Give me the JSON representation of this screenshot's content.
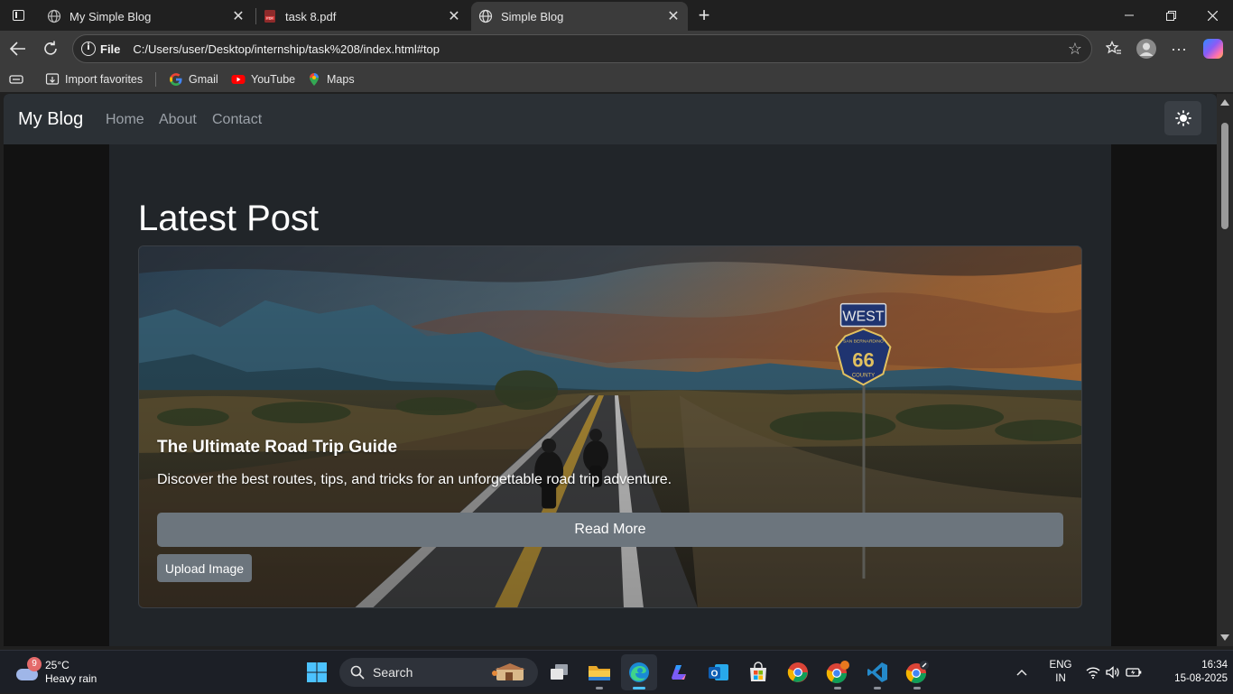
{
  "browser": {
    "tabs": [
      {
        "title": "My Simple Blog",
        "active": false
      },
      {
        "title": "task 8.pdf",
        "active": false
      },
      {
        "title": "Simple Blog",
        "active": true
      }
    ],
    "address": {
      "protocol_label": "File",
      "url": "C:/Users/user/Desktop/internship/task%208/index.html#top"
    },
    "favorites": [
      {
        "label": "Import favorites",
        "icon": "import-icon"
      },
      {
        "label": "Gmail",
        "icon": "google-icon"
      },
      {
        "label": "YouTube",
        "icon": "youtube-icon"
      },
      {
        "label": "Maps",
        "icon": "maps-icon"
      }
    ],
    "accent": "#4cc2ff"
  },
  "site": {
    "brand": "My Blog",
    "nav": [
      "Home",
      "About",
      "Contact"
    ],
    "theme_toggle_icon": "sun-icon",
    "section_title": "Latest Post",
    "post": {
      "title": "The Ultimate Road Trip Guide",
      "excerpt": "Discover the best routes, tips, and tricks for an unforgettable road trip adventure.",
      "read_more": "Read More",
      "upload": "Upload Image",
      "sign_top": "WEST",
      "sign_route": "66",
      "sign_upper": "SAN BERNARDINO",
      "sign_lower": "COUNTY"
    },
    "colors": {
      "navbar": "#2b3035",
      "body": "#212529",
      "button": "#6c757d"
    }
  },
  "taskbar": {
    "weather": {
      "temp": "25°C",
      "condition": "Heavy rain",
      "badge": "9"
    },
    "search_placeholder": "Search",
    "language": {
      "line1": "ENG",
      "line2": "IN"
    },
    "clock": {
      "time": "16:34",
      "date": "15-08-2025"
    }
  }
}
